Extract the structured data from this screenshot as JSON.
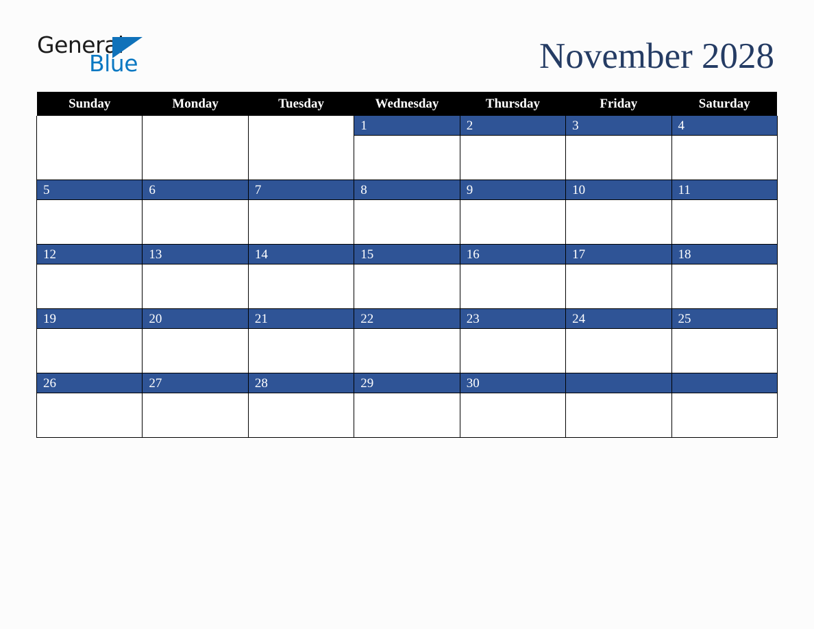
{
  "brand": {
    "name_part1": "General",
    "name_part2": "Blue",
    "triangle_icon": "triangle-icon",
    "colors": {
      "part1": "#1b1b1b",
      "part2": "#0b78c2",
      "triangle": "#1072ba"
    }
  },
  "header": {
    "title": "November 2028",
    "title_color": "#253c64"
  },
  "calendar": {
    "month": "November",
    "year": "2028",
    "theme": {
      "header_bg": "#000000",
      "header_text": "#ffffff",
      "date_bar_bg": "#2f5496",
      "date_text": "#ffffff",
      "cell_bg": "#ffffff",
      "grid_line": "#000000",
      "page_bg": "#fcfcfc"
    },
    "weekday_headers": [
      "Sunday",
      "Monday",
      "Tuesday",
      "Wednesday",
      "Thursday",
      "Friday",
      "Saturday"
    ],
    "weeks": [
      [
        {
          "day": "",
          "filled": false
        },
        {
          "day": "",
          "filled": false
        },
        {
          "day": "",
          "filled": false
        },
        {
          "day": "1",
          "filled": true
        },
        {
          "day": "2",
          "filled": true
        },
        {
          "day": "3",
          "filled": true
        },
        {
          "day": "4",
          "filled": true
        }
      ],
      [
        {
          "day": "5",
          "filled": true
        },
        {
          "day": "6",
          "filled": true
        },
        {
          "day": "7",
          "filled": true
        },
        {
          "day": "8",
          "filled": true
        },
        {
          "day": "9",
          "filled": true
        },
        {
          "day": "10",
          "filled": true
        },
        {
          "day": "11",
          "filled": true
        }
      ],
      [
        {
          "day": "12",
          "filled": true
        },
        {
          "day": "13",
          "filled": true
        },
        {
          "day": "14",
          "filled": true
        },
        {
          "day": "15",
          "filled": true
        },
        {
          "day": "16",
          "filled": true
        },
        {
          "day": "17",
          "filled": true
        },
        {
          "day": "18",
          "filled": true
        }
      ],
      [
        {
          "day": "19",
          "filled": true
        },
        {
          "day": "20",
          "filled": true
        },
        {
          "day": "21",
          "filled": true
        },
        {
          "day": "22",
          "filled": true
        },
        {
          "day": "23",
          "filled": true
        },
        {
          "day": "24",
          "filled": true
        },
        {
          "day": "25",
          "filled": true
        }
      ],
      [
        {
          "day": "26",
          "filled": true
        },
        {
          "day": "27",
          "filled": true
        },
        {
          "day": "28",
          "filled": true
        },
        {
          "day": "29",
          "filled": true
        },
        {
          "day": "30",
          "filled": true
        },
        {
          "day": "",
          "filled": true
        },
        {
          "day": "",
          "filled": true
        }
      ]
    ]
  }
}
